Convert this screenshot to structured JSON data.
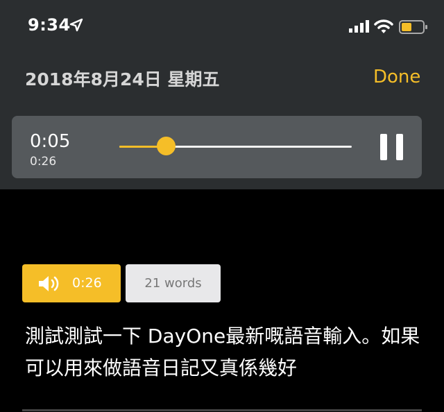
{
  "status_bar": {
    "time": "9:34",
    "icons": [
      "location-arrow-icon",
      "signal-icon",
      "wifi-icon",
      "battery-icon"
    ]
  },
  "header": {
    "date": "2018年8月24日 星期五",
    "done_label": "Done"
  },
  "player": {
    "current_time": "0:05",
    "duration": "0:26",
    "progress": 0.2
  },
  "audio_chip": {
    "duration": "0:26"
  },
  "word_count": "21 words",
  "entry_text": "測試測試一下 DayOne最新嘅語音輸入。如果可以用來做語音日記又真係幾好",
  "colors": {
    "accent": "#f5be28",
    "header_bg": "#2b2e30",
    "player_bg": "#55595c",
    "body_bg": "#000000"
  }
}
